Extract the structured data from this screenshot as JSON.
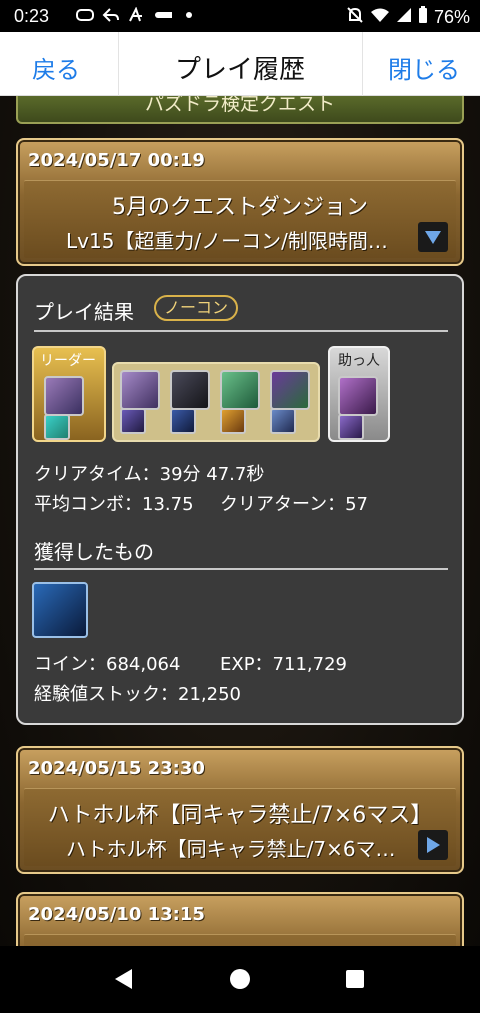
{
  "status_bar": {
    "time": "0:23",
    "battery": "76%"
  },
  "nav": {
    "back": "戻る",
    "title": "プレイ履歴",
    "close": "閉じる"
  },
  "top_strip": {
    "label": "パズドラ検定クエスト"
  },
  "card1": {
    "date": "2024/05/17 00:19",
    "title": "5月のクエストダンジョン",
    "subtitle": "Lv15【超重力/ノーコン/制限時間…"
  },
  "result": {
    "heading": "プレイ結果",
    "badge": "ノーコン",
    "leader_label": "リーダー",
    "helper_label": "助っ人",
    "clear_time": "クリアタイム：39分 47.7秒",
    "avg_combo": "平均コンボ：13.75",
    "clear_turn": "クリアターン：57",
    "obtained_heading": "獲得したもの",
    "coin": "コイン：684,064",
    "exp": "EXP：711,729",
    "exp_stock": "経験値ストック：21,250"
  },
  "card2": {
    "date": "2024/05/15 23:30",
    "title": "ハトホル杯【同キャラ禁止/7×6マス】",
    "subtitle": "ハトホル杯【同キャラ禁止/7×6マ…"
  },
  "card3": {
    "date": "2024/05/10 13:15"
  },
  "colors": {
    "link": "#1e7ce8",
    "gold": "#d9b24a"
  }
}
